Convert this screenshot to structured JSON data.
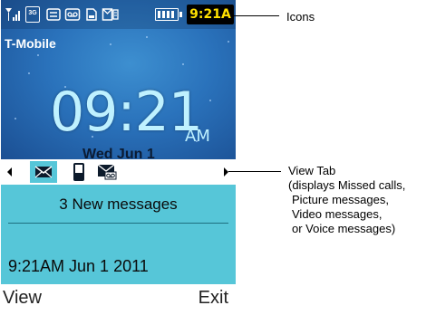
{
  "status_bar": {
    "network_type": "3G",
    "time": "9:21A"
  },
  "carrier": "T-Mobile",
  "clock": {
    "time": "09:21",
    "ampm": "AM",
    "date": "Wed Jun 1"
  },
  "tabs": [
    {
      "icon": "envelope-icon",
      "selected": true
    },
    {
      "icon": "phone-icon",
      "selected": false
    },
    {
      "icon": "voicemail-envelope-icon",
      "selected": false
    }
  ],
  "messages": {
    "count_label": "3 New messages",
    "timestamp": "9:21AM Jun 1 2011"
  },
  "softkeys": {
    "left": "View",
    "right": "Exit"
  },
  "callouts": {
    "icons": "Icons",
    "view_tab": [
      "View Tab",
      "(displays Missed calls,",
      "Picture messages,",
      "Video messages,",
      "or Voice messages)"
    ]
  },
  "colors": {
    "panel_accent": "#56c6d8",
    "tab_selected_bg": "#56c6d8",
    "clock_text": "#bff1ff",
    "status_time_text": "#ffe000"
  }
}
